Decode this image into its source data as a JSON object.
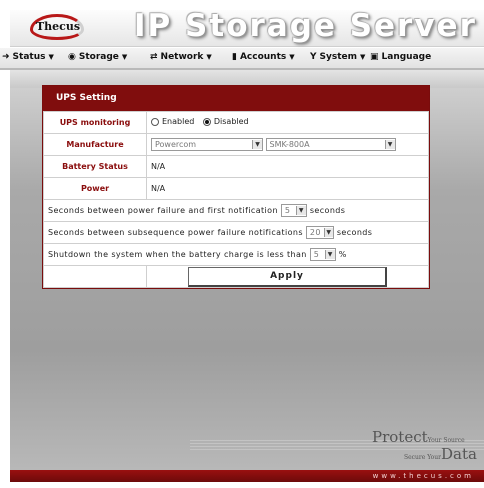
{
  "header": {
    "logo_text": "Thecus",
    "title": "IP Storage Server"
  },
  "menu": [
    {
      "label": "Status",
      "icon": "pointer-icon"
    },
    {
      "label": "Storage",
      "icon": "disk-icon"
    },
    {
      "label": "Network",
      "icon": "network-icon"
    },
    {
      "label": "Accounts",
      "icon": "accounts-icon"
    },
    {
      "label": "System",
      "icon": "system-icon"
    },
    {
      "label": "Language",
      "icon": "language-icon"
    }
  ],
  "panel": {
    "title": "UPS Setting",
    "rows": {
      "monitoring_label": "UPS monitoring",
      "enabled_label": "Enabled",
      "disabled_label": "Disabled",
      "monitoring_value": "Disabled",
      "manufacture_label": "Manufacture",
      "manufacturer_value": "Powercom",
      "model_value": "SMK-800A",
      "battery_label": "Battery Status",
      "battery_value": "N/A",
      "power_label": "Power",
      "power_value": "N/A",
      "first_notify_prefix": "Seconds between power failure and first notification",
      "first_notify_value": "5",
      "first_notify_suffix": "seconds",
      "subseq_prefix": "Seconds between subsequence power failure notifications",
      "subseq_value": "20",
      "subseq_suffix": "seconds",
      "shutdown_prefix": "Shutdown the system when the battery charge is less than",
      "shutdown_value": "5",
      "shutdown_suffix": "%"
    },
    "apply_label": "Apply"
  },
  "footer": {
    "protect": "Protect",
    "your_source": "Your Source",
    "secure_your": "Secure Your",
    "data": "Data",
    "url": "www.thecus.com"
  },
  "colors": {
    "accent": "#800d0d",
    "label_red": "#8a0d0d"
  }
}
